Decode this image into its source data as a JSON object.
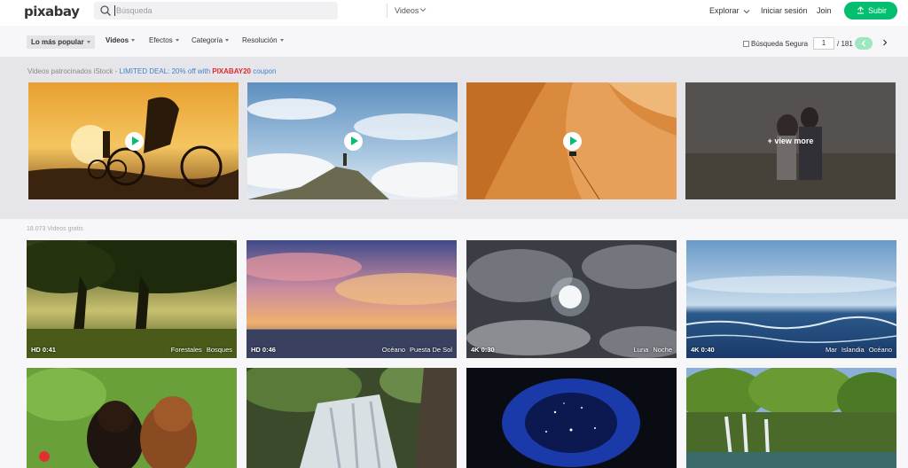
{
  "header": {
    "logo": "pixabay",
    "search_placeholder": "Búsqueda",
    "search_type": "Videos",
    "explore": "Explorar",
    "login": "Iniciar sesión",
    "join": "Join",
    "upload": "Subir"
  },
  "filters": {
    "sort": "Lo más popular",
    "media": "Videos",
    "effects": "Efectos",
    "category": "Categoría",
    "resolution": "Resolución",
    "safe_search": "Búsqueda Segura",
    "page": "1",
    "page_total": "/ 181"
  },
  "sponsored": {
    "prefix": "Videos patrocinados iStock - ",
    "deal": "LIMITED DEAL: 20% off with ",
    "code": "PIXABAY20",
    "suffix": " coupon",
    "view_more": "+ view more"
  },
  "results": {
    "count": "18.073 Videos gratis",
    "cards": [
      {
        "quality": "HD 0:41",
        "tags": [
          "Forestales",
          "Bosques"
        ]
      },
      {
        "quality": "HD 0:46",
        "tags": [
          "Océano",
          "Puesta De Sol"
        ]
      },
      {
        "quality": "4K 0:30",
        "tags": [
          "Luna",
          "Noche"
        ]
      },
      {
        "quality": "4K 0:40",
        "tags": [
          "Mar",
          "Islandia",
          "Océano"
        ]
      }
    ]
  },
  "colors": {
    "brand_green": "#02be6e",
    "coupon_red": "#e2262d",
    "deal_blue": "#3c83c8"
  },
  "icons": [
    "search-icon",
    "chevron-down-icon",
    "upload-icon",
    "play-icon",
    "chevron-left-icon",
    "chevron-right-icon"
  ]
}
